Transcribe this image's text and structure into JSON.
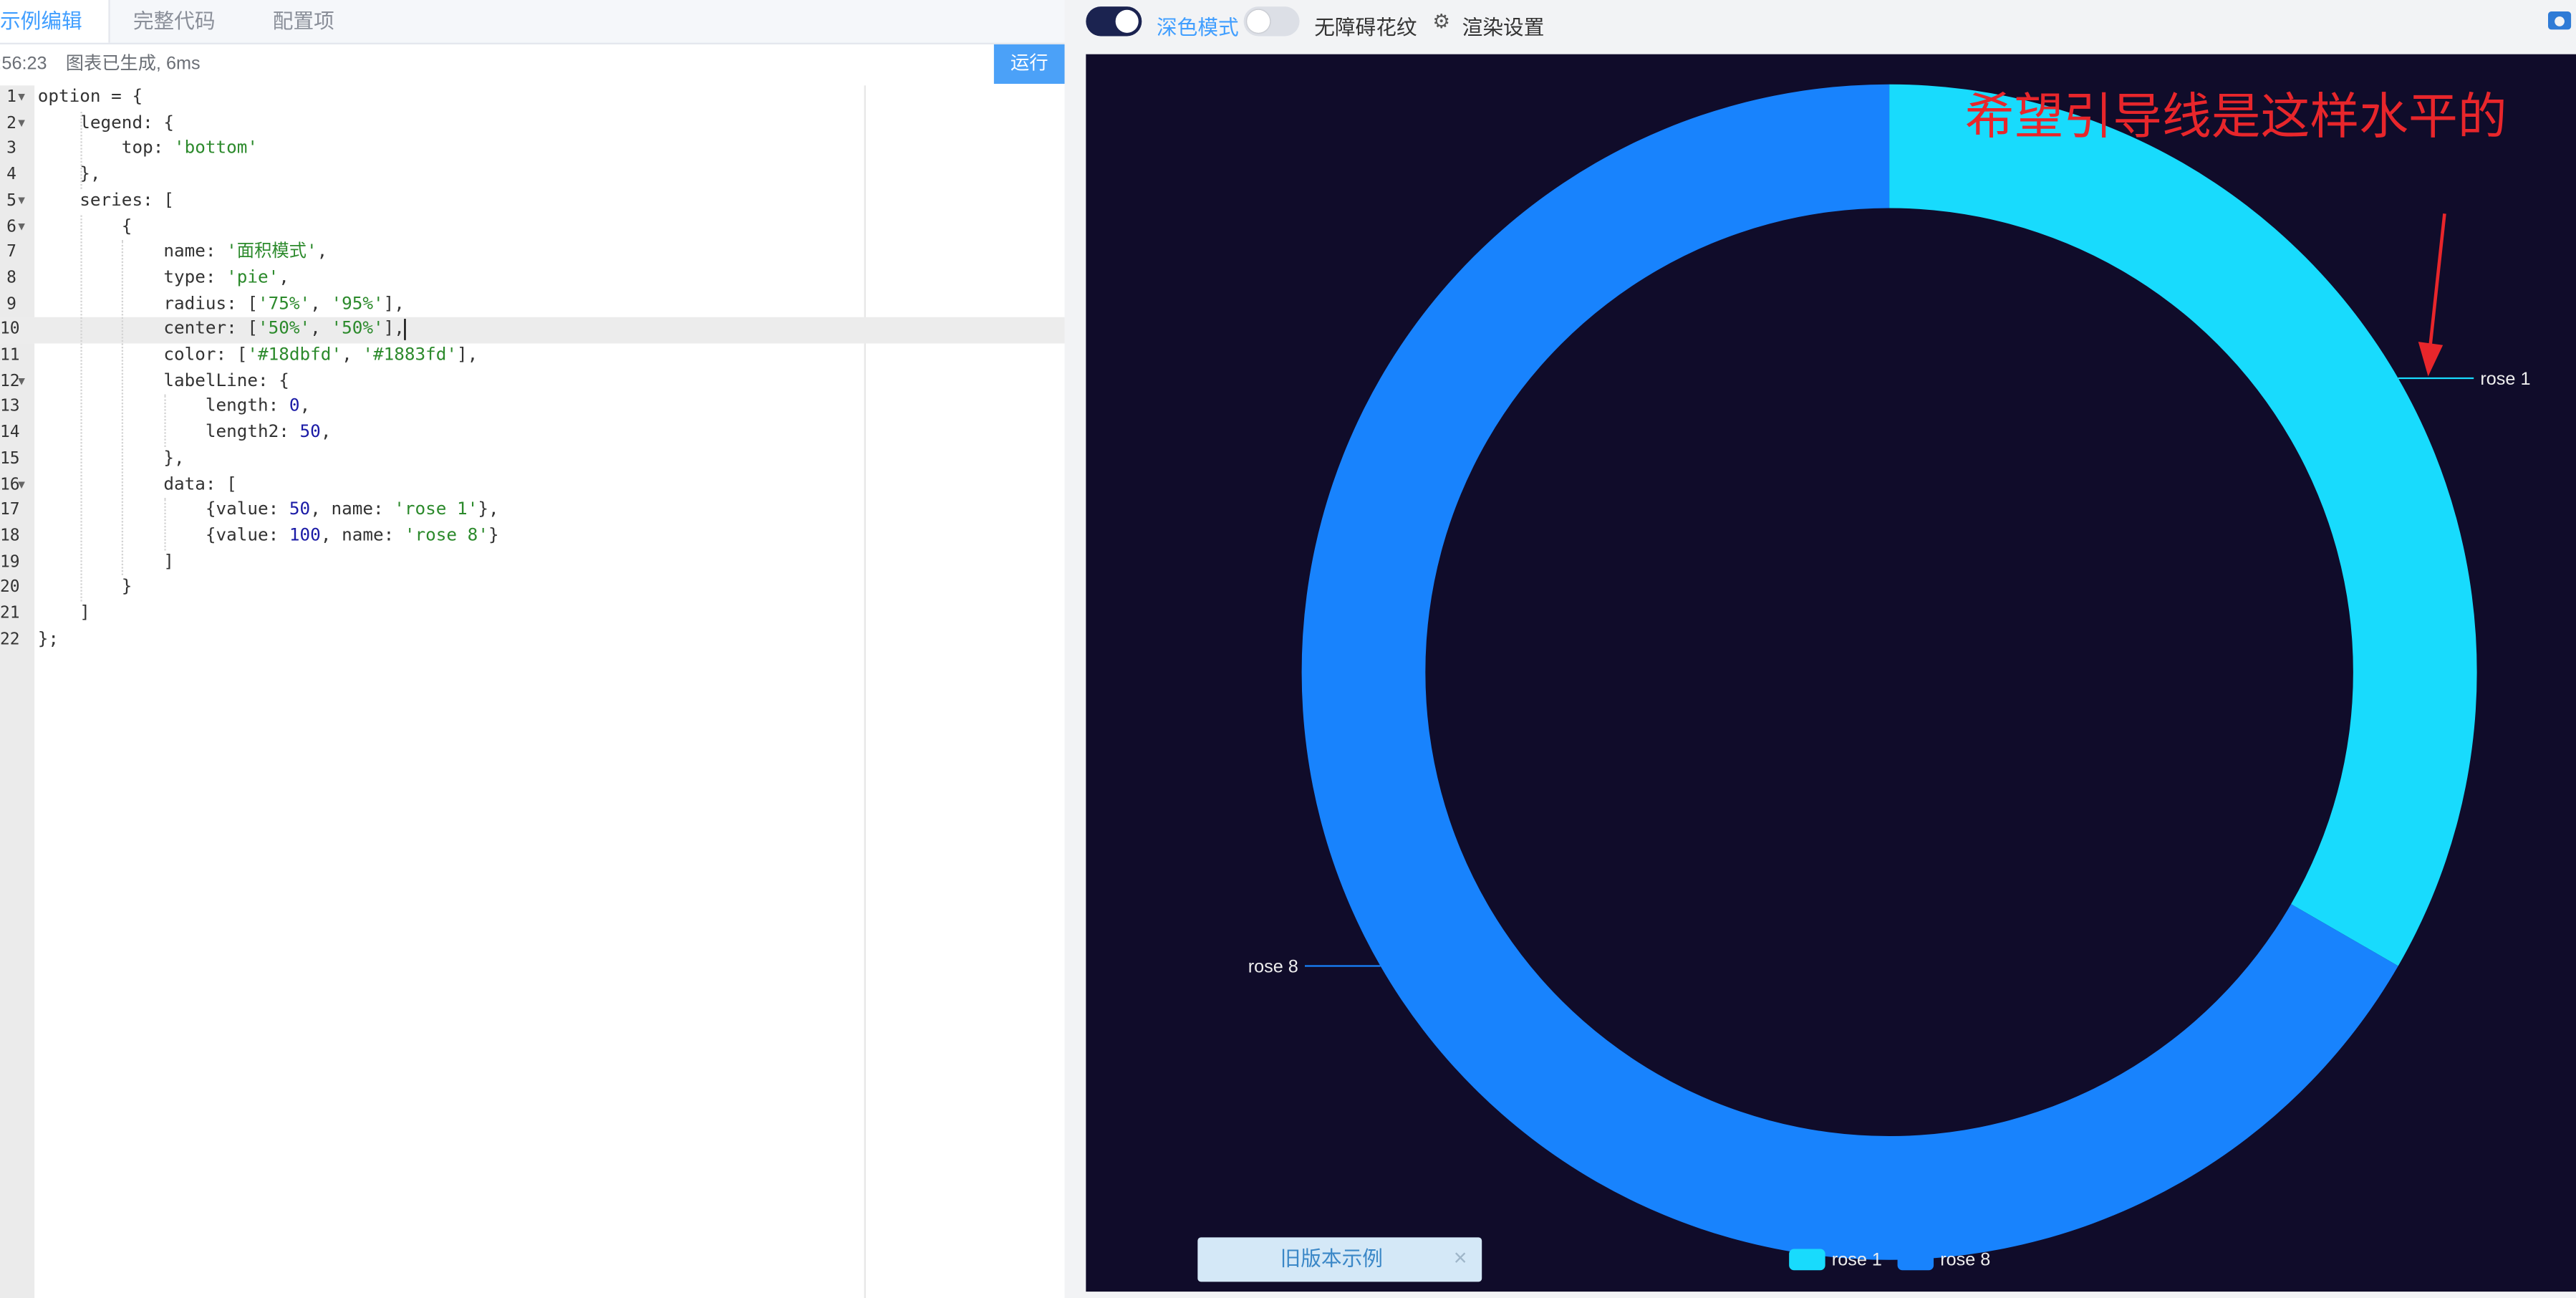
{
  "editor": {
    "tabs": [
      "示例编辑",
      "完整代码",
      "配置项"
    ],
    "status_time": ":56:23",
    "status_message": "图表已生成, 6ms",
    "run_label": "运行",
    "lines": [
      {
        "n": "1",
        "fold": true,
        "parts": [
          [
            "t",
            "option = {"
          ]
        ]
      },
      {
        "n": "2",
        "fold": true,
        "parts": [
          [
            "t",
            "    legend: {"
          ]
        ]
      },
      {
        "n": "3",
        "fold": false,
        "parts": [
          [
            "t",
            "        top: "
          ],
          [
            "s",
            "'bottom'"
          ]
        ]
      },
      {
        "n": "4",
        "fold": false,
        "parts": [
          [
            "t",
            "    },"
          ]
        ]
      },
      {
        "n": "5",
        "fold": true,
        "parts": [
          [
            "t",
            "    series: ["
          ]
        ]
      },
      {
        "n": "6",
        "fold": true,
        "parts": [
          [
            "t",
            "        {"
          ]
        ]
      },
      {
        "n": "7",
        "fold": false,
        "parts": [
          [
            "t",
            "            name: "
          ],
          [
            "s",
            "'面积模式'"
          ],
          [
            "t",
            ","
          ]
        ]
      },
      {
        "n": "8",
        "fold": false,
        "parts": [
          [
            "t",
            "            type: "
          ],
          [
            "s",
            "'pie'"
          ],
          [
            "t",
            ","
          ]
        ]
      },
      {
        "n": "9",
        "fold": false,
        "parts": [
          [
            "t",
            "            radius: ["
          ],
          [
            "s",
            "'75%'"
          ],
          [
            "t",
            ", "
          ],
          [
            "s",
            "'95%'"
          ],
          [
            "t",
            "],"
          ]
        ]
      },
      {
        "n": "10",
        "fold": false,
        "parts": [
          [
            "t",
            "            center: ["
          ],
          [
            "s",
            "'50%'"
          ],
          [
            "t",
            ", "
          ],
          [
            "s",
            "'50%'"
          ],
          [
            "t",
            "],"
          ]
        ]
      },
      {
        "n": "11",
        "fold": false,
        "parts": [
          [
            "t",
            "            color: ["
          ],
          [
            "s",
            "'#18dbfd'"
          ],
          [
            "t",
            ", "
          ],
          [
            "s",
            "'#1883fd'"
          ],
          [
            "t",
            "],"
          ]
        ]
      },
      {
        "n": "12",
        "fold": true,
        "parts": [
          [
            "t",
            "            labelLine: {"
          ]
        ]
      },
      {
        "n": "13",
        "fold": false,
        "parts": [
          [
            "t",
            "                length: "
          ],
          [
            "n",
            "0"
          ],
          [
            "t",
            ","
          ]
        ]
      },
      {
        "n": "14",
        "fold": false,
        "parts": [
          [
            "t",
            "                length2: "
          ],
          [
            "n",
            "50"
          ],
          [
            "t",
            ","
          ]
        ]
      },
      {
        "n": "15",
        "fold": false,
        "parts": [
          [
            "t",
            "            },"
          ]
        ]
      },
      {
        "n": "16",
        "fold": true,
        "parts": [
          [
            "t",
            "            data: ["
          ]
        ]
      },
      {
        "n": "17",
        "fold": false,
        "parts": [
          [
            "t",
            "                {value: "
          ],
          [
            "n",
            "50"
          ],
          [
            "t",
            ", name: "
          ],
          [
            "s",
            "'rose 1'"
          ],
          [
            "t",
            "},"
          ]
        ]
      },
      {
        "n": "18",
        "fold": false,
        "parts": [
          [
            "t",
            "                {value: "
          ],
          [
            "n",
            "100"
          ],
          [
            "t",
            ", name: "
          ],
          [
            "s",
            "'rose 8'"
          ],
          [
            "t",
            "}"
          ]
        ]
      },
      {
        "n": "19",
        "fold": false,
        "parts": [
          [
            "t",
            "            ]"
          ]
        ]
      },
      {
        "n": "20",
        "fold": false,
        "parts": [
          [
            "t",
            "        }"
          ]
        ]
      },
      {
        "n": "21",
        "fold": false,
        "parts": [
          [
            "t",
            "    ]"
          ]
        ]
      },
      {
        "n": "22",
        "fold": false,
        "parts": [
          [
            "t",
            "};"
          ]
        ]
      }
    ],
    "highlight_line": 10
  },
  "toolbar": {
    "dark_mode_label": "深色模式",
    "dark_mode_on": true,
    "aria_label": "无障碍花纹",
    "aria_on": false,
    "render_settings_label": "渲染设置"
  },
  "chart_data": {
    "type": "pie",
    "variant": "donut",
    "radius_percent": [
      75,
      95
    ],
    "values": [
      {
        "name": "rose 1",
        "value": 50,
        "color": "#18dbfd"
      },
      {
        "name": "rose 8",
        "value": 100,
        "color": "#1883fd"
      }
    ],
    "legend_position": "bottom",
    "background": "#100c2a",
    "annotation": "希望引导线是这样水平的",
    "annotation_color": "#e8262b"
  },
  "old_version_button": {
    "label": "旧版本示例",
    "close": "×"
  }
}
